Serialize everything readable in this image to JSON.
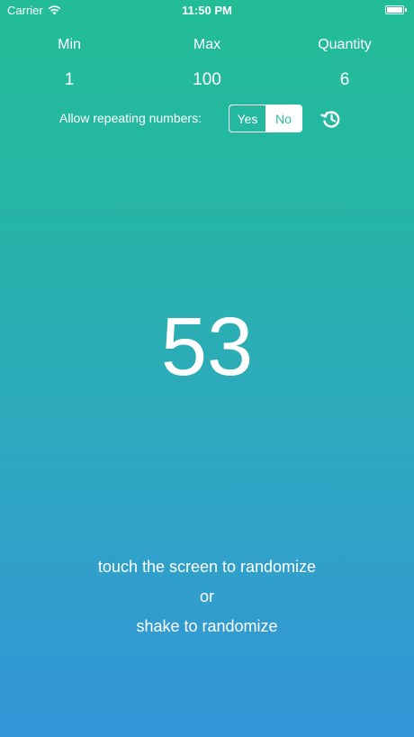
{
  "status_bar": {
    "carrier": "Carrier",
    "time": "11:50 PM",
    "wifi_icon": "wifi-icon",
    "battery_icon": "battery-icon"
  },
  "settings": {
    "min": {
      "label": "Min",
      "value": "1"
    },
    "max": {
      "label": "Max",
      "value": "100"
    },
    "quantity": {
      "label": "Quantity",
      "value": "6"
    }
  },
  "repeating": {
    "label": "Allow repeating numbers:",
    "options": [
      "Yes",
      "No"
    ],
    "selected": "No",
    "history_icon": "history-icon"
  },
  "result": {
    "number": "53"
  },
  "instructions": {
    "line1": "touch the screen to randomize",
    "line2": "or",
    "line3": "shake to randomize"
  },
  "colors": {
    "gradient_top": "#22bd96",
    "gradient_bottom": "#3495d9",
    "text": "#ffffff",
    "segment_selected_text": "#2dbd9b"
  }
}
